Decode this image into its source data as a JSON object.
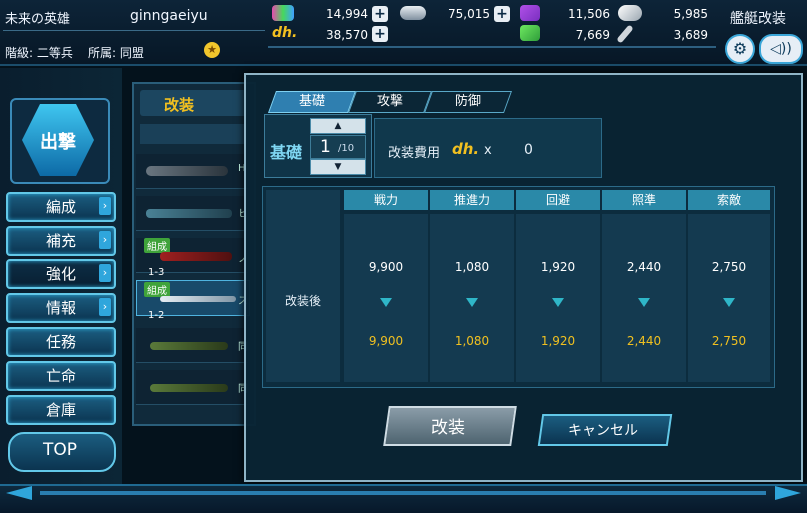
{
  "header": {
    "player_title": "未来の英雄",
    "player_name": "ginngaeiyu",
    "rank_label": "階級: 二等兵",
    "faction_label": "所属: 同盟",
    "screen_title": "艦艇改装"
  },
  "resources": {
    "res1": "14,994",
    "res2": "75,015",
    "res3": "11,506",
    "res4": "5,985",
    "dh": "38,570",
    "res5": "7,669",
    "res6": "3,689"
  },
  "nav": {
    "sortie": "出撃",
    "items": [
      "編成",
      "補充",
      "強化",
      "情報",
      "任務",
      "亡命",
      "倉庫"
    ],
    "top": "TOP"
  },
  "shiplist": {
    "header": "改装",
    "badge": "組成",
    "levels": [
      "1-3",
      "1-2"
    ],
    "partial_labels": [
      "H",
      "ヒ",
      "ノ",
      "ス",
      "同",
      "同"
    ]
  },
  "modal": {
    "tabs": [
      "基礎",
      "攻撃",
      "防御"
    ],
    "section_label": "基礎",
    "level_value": "1",
    "level_max": "/10",
    "cost_label": "改装費用",
    "cost_currency": "dh.",
    "cost_x": "x",
    "cost_value": "0",
    "columns": [
      "戦力",
      "推進力",
      "回避",
      "照準",
      "索敵"
    ],
    "before_values": [
      "9,900",
      "1,080",
      "1,920",
      "2,440",
      "2,750"
    ],
    "after_label": "改装後",
    "after_values": [
      "9,900",
      "1,080",
      "1,920",
      "2,440",
      "2,750"
    ],
    "ok_button": "改装",
    "cancel_button": "キャンセル"
  },
  "colors": {
    "accent": "#2fa6dc",
    "after_value": "#f0c020",
    "header_cell": "#2a89a8"
  }
}
